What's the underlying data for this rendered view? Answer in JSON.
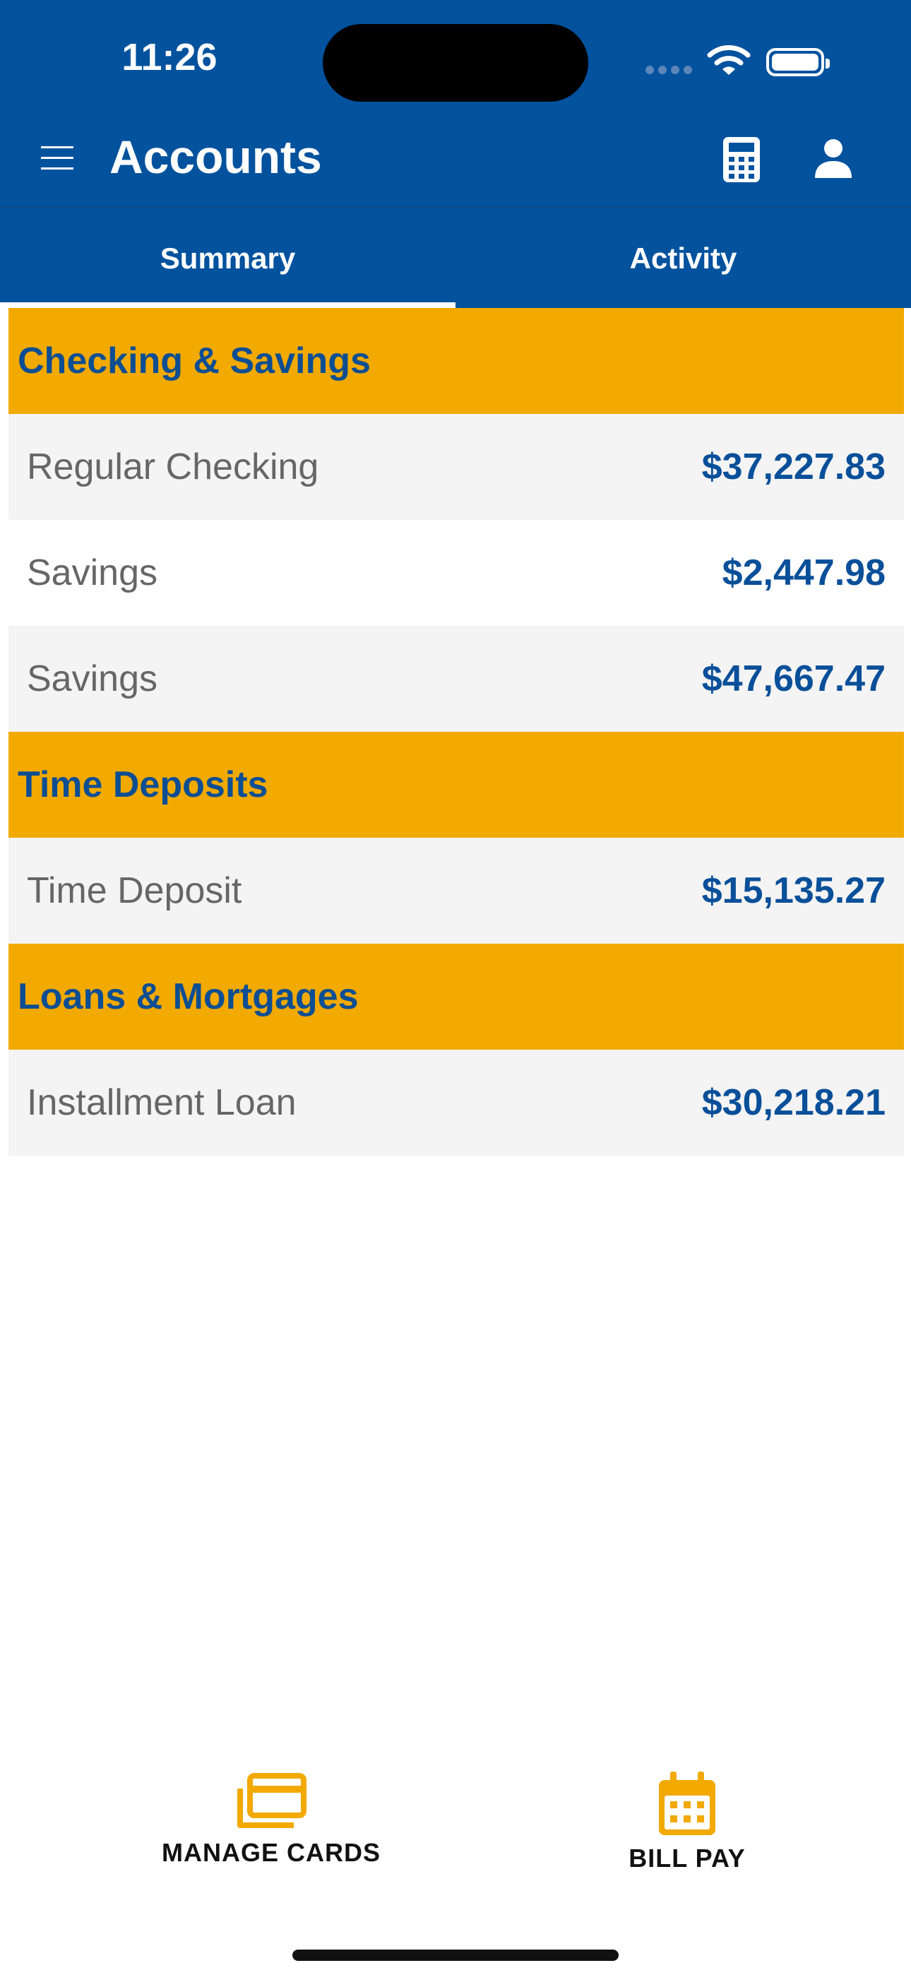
{
  "status_bar": {
    "time": "11:26"
  },
  "header": {
    "title": "Accounts"
  },
  "tabs": [
    {
      "label": "Summary",
      "selected": true
    },
    {
      "label": "Activity",
      "selected": false
    }
  ],
  "sections": [
    {
      "title": "Checking & Savings",
      "accounts": [
        {
          "name": "Regular Checking",
          "balance": "$37,227.83"
        },
        {
          "name": "Savings",
          "balance": "$2,447.98"
        },
        {
          "name": "Savings",
          "balance": "$47,667.47"
        }
      ]
    },
    {
      "title": "Time Deposits",
      "accounts": [
        {
          "name": "Time Deposit",
          "balance": "$15,135.27"
        }
      ]
    },
    {
      "title": "Loans & Mortgages",
      "accounts": [
        {
          "name": "Installment Loan",
          "balance": "$30,218.21"
        }
      ]
    }
  ],
  "bottom_actions": [
    {
      "label": "MANAGE CARDS",
      "icon": "cards-icon"
    },
    {
      "label": "BILL PAY",
      "icon": "calendar-icon"
    }
  ],
  "colors": {
    "brand_blue": "#02529e",
    "section_gold": "#f2a900",
    "balance_blue": "#0a4f99",
    "row_shade": "#f4f4f4"
  }
}
